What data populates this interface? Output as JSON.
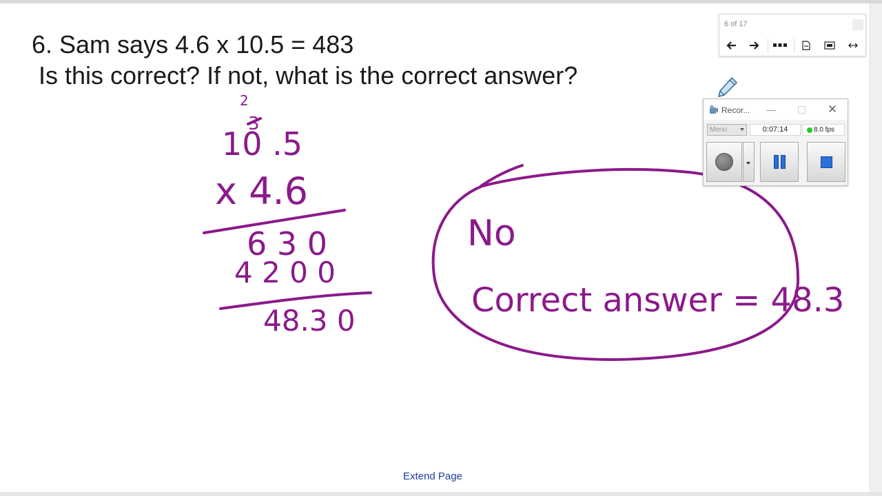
{
  "question": {
    "line1": "6.  Sam says 4.6 x 10.5 = 483",
    "line2": "Is this correct? If not, what is the correct answer?"
  },
  "handwriting": {
    "carry_top": "2",
    "carry_crossed": "3",
    "multiplicand": "10 .5",
    "multiplier": "x 4.6",
    "partial_1": "6 3 0",
    "partial_2": "4 2 0 0",
    "product": "48.3 0",
    "answer_no": "No",
    "answer_correct": "Correct answer = 48.3"
  },
  "colors": {
    "ink": "#8b1a8b",
    "link": "#1f3f99",
    "record_blue": "#2a72d8"
  },
  "footer": {
    "extend_page": "Extend Page"
  },
  "page_nav": {
    "counter": "6 of 17",
    "icons": [
      "arrow-left-icon",
      "arrow-right-icon",
      "more-dots-icon",
      "page-icon",
      "fit-screen-icon",
      "fit-width-icon"
    ]
  },
  "recorder": {
    "title": "Recor...",
    "menu_label": "Menu",
    "timer": "0:07:14",
    "fps": "8.0 fps"
  }
}
